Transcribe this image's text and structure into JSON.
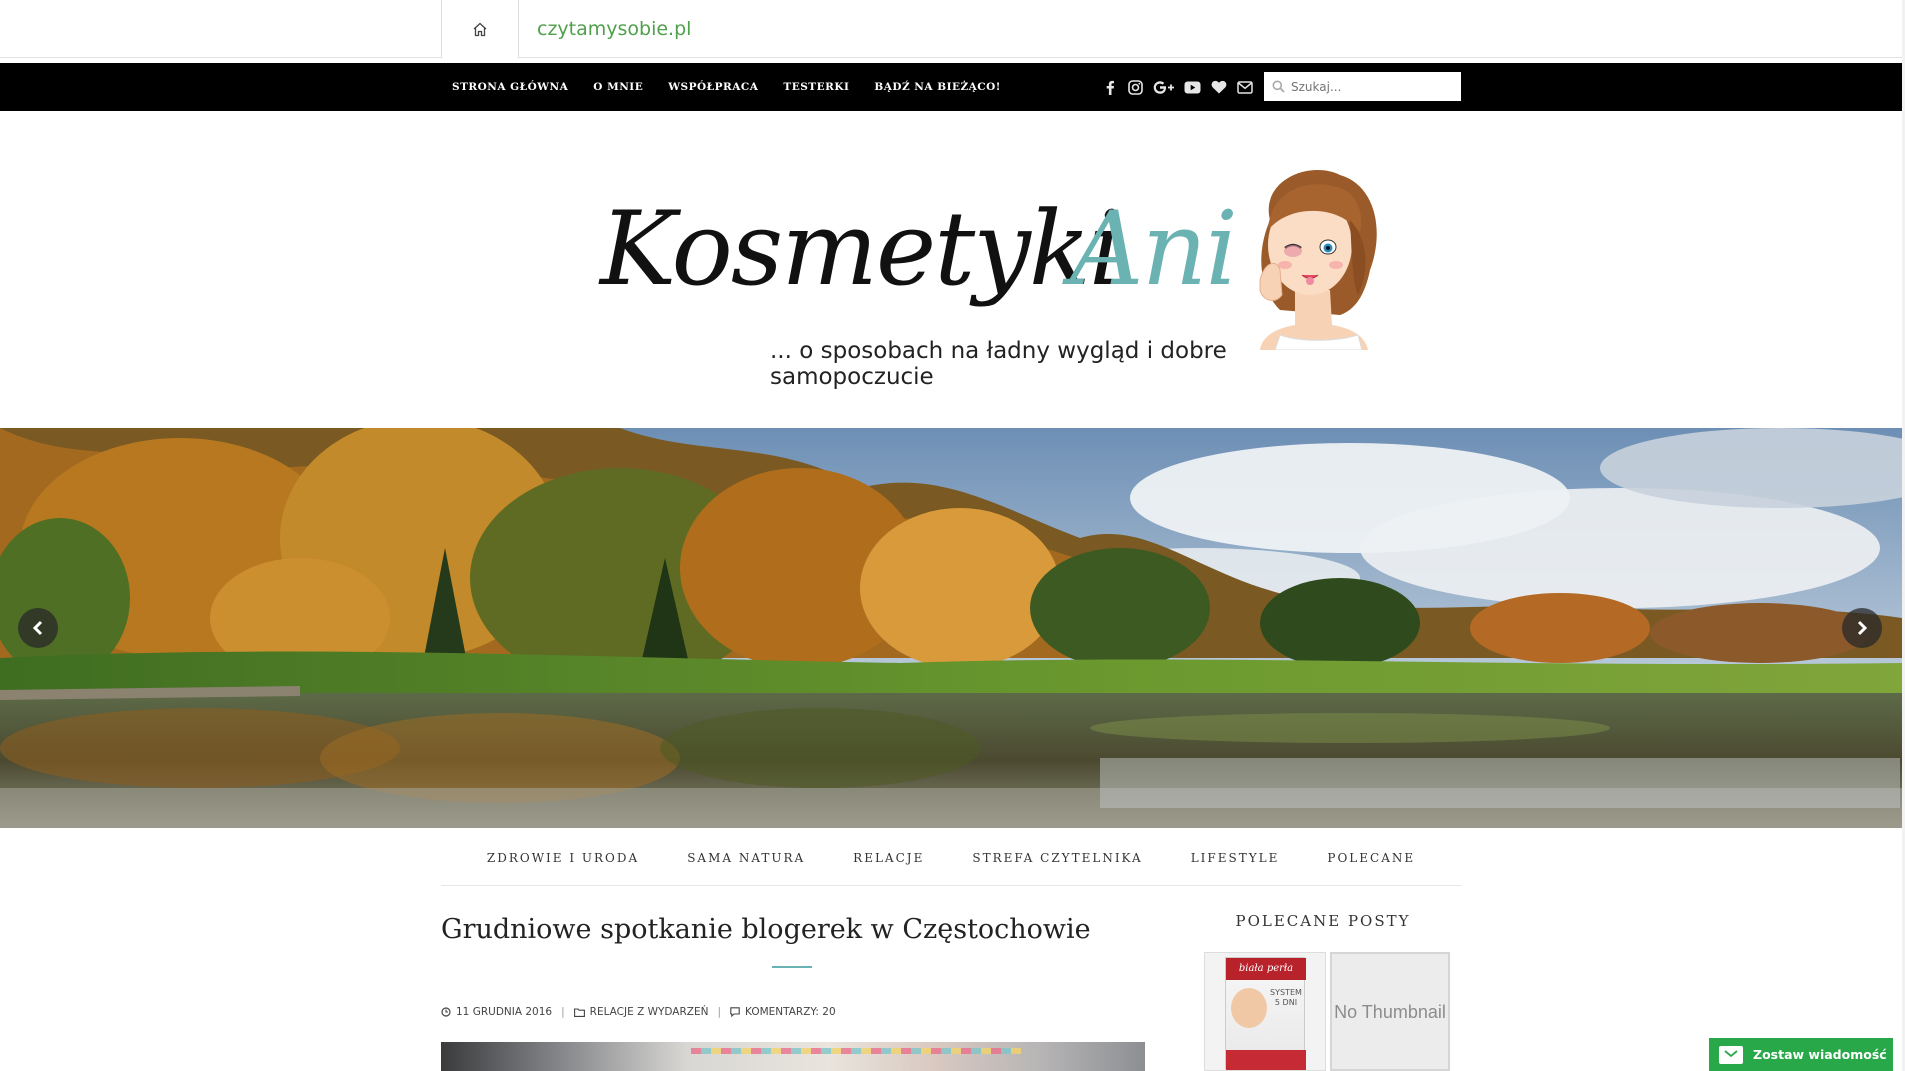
{
  "topbar": {
    "site_link": "czytamysobie.pl",
    "home_icon": "home-icon"
  },
  "nav": {
    "items": [
      "STRONA GŁÓWNA",
      "O MNIE",
      "WSPÓŁPRACA",
      "TESTERKI",
      "BĄDŹ NA BIEŻĄCO!"
    ],
    "social_icons": [
      "facebook-icon",
      "instagram-icon",
      "google-plus-icon",
      "youtube-icon",
      "heart-icon",
      "mail-icon"
    ],
    "search_placeholder": "Szukaj..."
  },
  "logo": {
    "part1": "Kosmetyki",
    "part2": "Ani",
    "tagline": "... o sposobach na ładny wygląd i dobre samopoczucie",
    "accent_color": "#6ab3b2"
  },
  "slider": {
    "prev_icon": "chevron-left-icon",
    "next_icon": "chevron-right-icon"
  },
  "categories": [
    "ZDROWIE I URODA",
    "SAMA NATURA",
    "RELACJE",
    "STREFA CZYTELNIKA",
    "LIFESTYLE",
    "POLECANE"
  ],
  "post": {
    "title": "Grudniowe spotkanie blogerek w Częstochowie",
    "date": "11 GRUDNIA 2016",
    "category": "RELACJE Z WYDARZEŃ",
    "comments": "KOMENTARZY: 20"
  },
  "sidebar": {
    "title": "POLECANE POSTY",
    "thumb1": {
      "brand": "biała perła",
      "text": "SYSTEM 5 DNI"
    },
    "thumb2_text": "No Thumbnail"
  },
  "contact": {
    "label": "Zostaw wiadomość"
  }
}
